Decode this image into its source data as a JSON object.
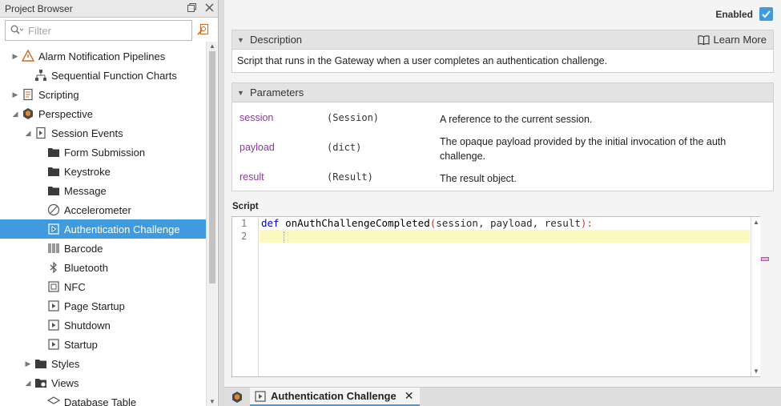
{
  "project_browser": {
    "title": "Project Browser",
    "filter_placeholder": "Filter",
    "tree": [
      {
        "label": "Alarm Notification Pipelines",
        "icon": "alarm-pipeline-icon",
        "arrow": "▶"
      },
      {
        "label": "Sequential Function Charts",
        "icon": "sfc-icon",
        "arrow": ""
      },
      {
        "label": "Scripting",
        "icon": "scripting-icon",
        "arrow": "▶"
      },
      {
        "label": "Perspective",
        "icon": "perspective-icon",
        "arrow": "◢"
      },
      {
        "label": "Session Events",
        "icon": "session-events-icon",
        "arrow": "◢"
      },
      {
        "label": "Form Submission",
        "icon": "folder-icon",
        "arrow": ""
      },
      {
        "label": "Keystroke",
        "icon": "folder-icon",
        "arrow": ""
      },
      {
        "label": "Message",
        "icon": "folder-icon",
        "arrow": ""
      },
      {
        "label": "Accelerometer",
        "icon": "accelerometer-icon",
        "arrow": ""
      },
      {
        "label": "Authentication Challenge",
        "icon": "script-event-icon",
        "arrow": ""
      },
      {
        "label": "Barcode",
        "icon": "barcode-icon",
        "arrow": ""
      },
      {
        "label": "Bluetooth",
        "icon": "bluetooth-icon",
        "arrow": ""
      },
      {
        "label": "NFC",
        "icon": "nfc-icon",
        "arrow": ""
      },
      {
        "label": "Page Startup",
        "icon": "script-event-icon",
        "arrow": ""
      },
      {
        "label": "Shutdown",
        "icon": "script-event-icon",
        "arrow": ""
      },
      {
        "label": "Startup",
        "icon": "script-event-icon",
        "arrow": ""
      },
      {
        "label": "Styles",
        "icon": "folder-icon",
        "arrow": "▶"
      },
      {
        "label": "Views",
        "icon": "views-icon",
        "arrow": "◢"
      },
      {
        "label": "Database Table",
        "icon": "view-icon",
        "arrow": ""
      }
    ]
  },
  "editor_panel": {
    "enabled_label": "Enabled",
    "enabled": true,
    "description": {
      "header": "Description",
      "learn_more": "Learn More",
      "text": "Script that runs in the Gateway when a user completes an authentication challenge."
    },
    "parameters": {
      "header": "Parameters",
      "items": [
        {
          "name": "session",
          "type": "(Session)",
          "desc": "A reference to the current session."
        },
        {
          "name": "payload",
          "type": "(dict)",
          "desc": "The opaque payload provided by the initial invocation of the auth challenge."
        },
        {
          "name": "result",
          "type": "(Result)",
          "desc": "The result object."
        }
      ]
    },
    "script": {
      "label": "Script",
      "line_numbers": [
        "1",
        "2"
      ],
      "keyword": "def",
      "function_name": "onAuthChallengeCompleted",
      "open_paren": "(",
      "args": "session, payload, result",
      "close": "):"
    }
  },
  "tabs": {
    "active_label": "Authentication Challenge",
    "close_glyph": "✕"
  },
  "colors": {
    "selection": "#3f9bde",
    "param_name": "#8a3a9a",
    "keyword": "#0000cc",
    "current_line": "#fcf9c0"
  }
}
